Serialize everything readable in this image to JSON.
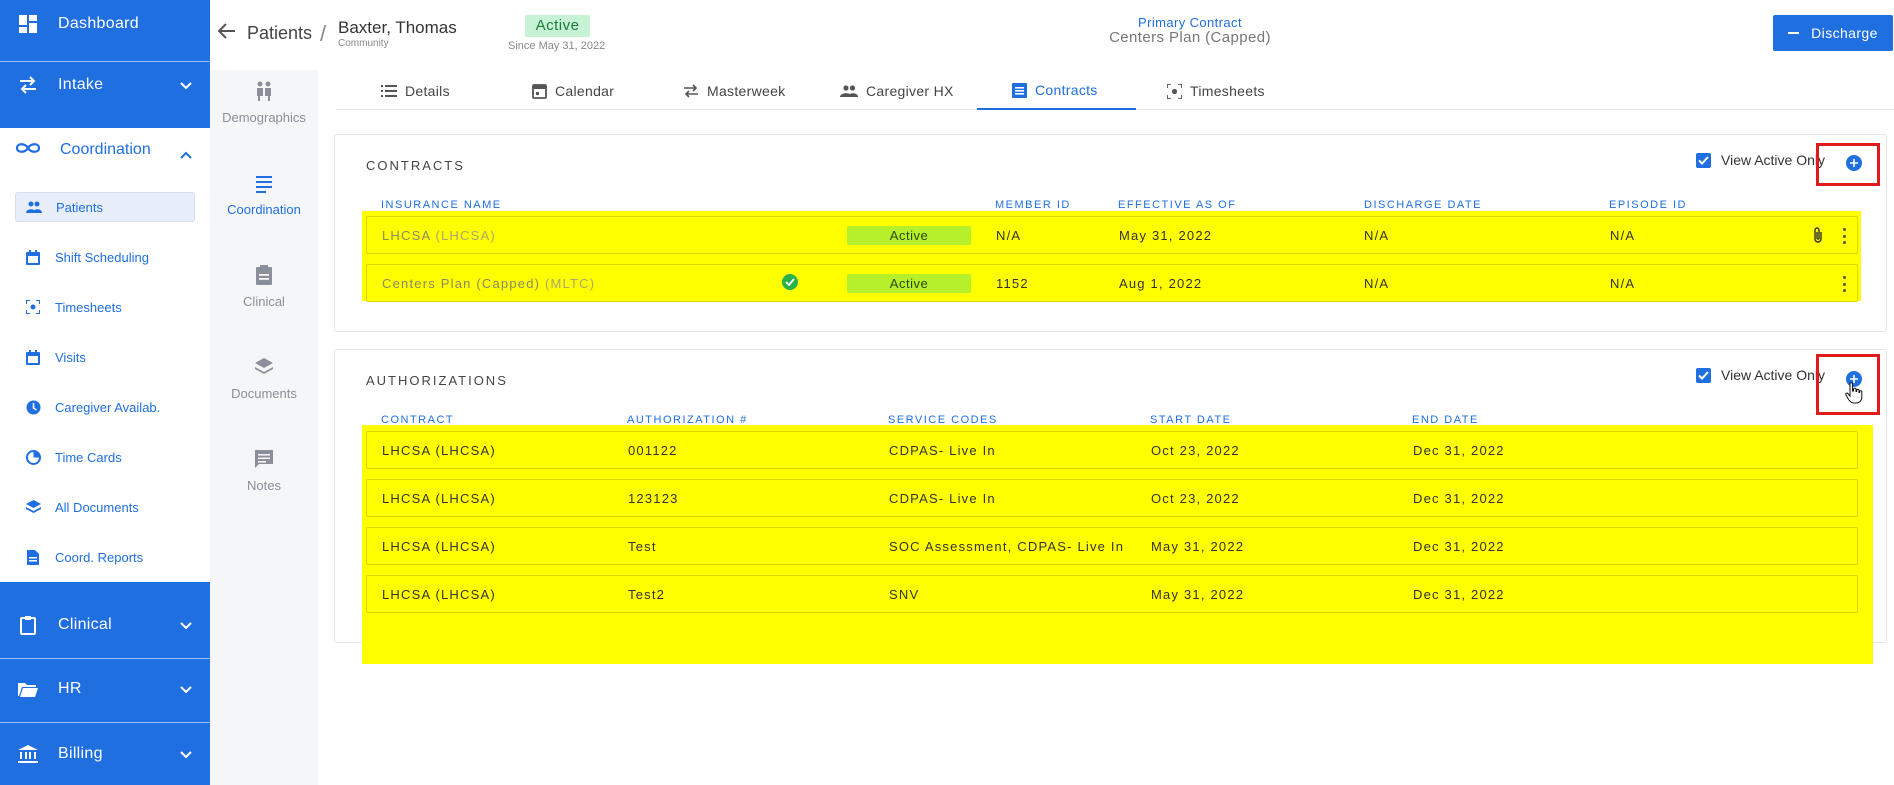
{
  "nav": {
    "dashboard": "Dashboard",
    "intake": "Intake",
    "coordination": "Coordination",
    "sub_items": [
      "Patients",
      "Shift Scheduling",
      "Timesheets",
      "Visits",
      "Caregiver Availab.",
      "Time Cards",
      "All Documents",
      "Coord. Reports"
    ],
    "clinical": "Clinical",
    "hr": "HR",
    "billing": "Billing"
  },
  "subnav": [
    "Demographics",
    "Coordination",
    "Clinical",
    "Documents",
    "Notes"
  ],
  "header": {
    "crumb": "Patients",
    "slash": "/",
    "name": "Baxter, Thomas",
    "subtitle": "Community",
    "status": "Active",
    "since": "Since May 31, 2022",
    "primary_contract_label": "Primary Contract",
    "primary_contract_value": "Centers Plan (Capped)",
    "discharge_label": "Discharge"
  },
  "tabs": [
    "Details",
    "Calendar",
    "Masterweek",
    "Caregiver HX",
    "Contracts",
    "Timesheets"
  ],
  "contracts": {
    "title": "CONTRACTS",
    "view_active_only": "View Active Only",
    "columns": [
      "INSURANCE NAME",
      "MEMBER ID",
      "EFFECTIVE AS OF",
      "DISCHARGE DATE",
      "EPISODE ID"
    ],
    "rows": [
      {
        "name": "LHCSA",
        "code": "(LHCSA)",
        "status": "Active",
        "member_id": "N/A",
        "effective": "May 31, 2022",
        "discharge": "N/A",
        "episode": "N/A"
      },
      {
        "name": "Centers Plan (Capped)",
        "code": "(MLTC)",
        "status": "Active",
        "member_id": "1152",
        "effective": "Aug 1, 2022",
        "discharge": "N/A",
        "episode": "N/A"
      }
    ]
  },
  "authorizations": {
    "title": "AUTHORIZATIONS",
    "view_active_only": "View Active Only",
    "columns": [
      "CONTRACT",
      "AUTHORIZATION #",
      "SERVICE CODES",
      "START DATE",
      "END DATE"
    ],
    "rows": [
      {
        "contract": "LHCSA (LHCSA)",
        "auth": "001122",
        "codes": "CDPAS- Live In",
        "start": "Oct 23, 2022",
        "end": "Dec 31, 2022"
      },
      {
        "contract": "LHCSA (LHCSA)",
        "auth": "123123",
        "codes": "CDPAS- Live In",
        "start": "Oct 23, 2022",
        "end": "Dec 31, 2022"
      },
      {
        "contract": "LHCSA (LHCSA)",
        "auth": "Test",
        "codes": "SOC Assessment, CDPAS- Live In",
        "start": "May 31, 2022",
        "end": "Dec 31, 2022"
      },
      {
        "contract": "LHCSA (LHCSA)",
        "auth": "Test2",
        "codes": "SNV",
        "start": "May 31, 2022",
        "end": "Dec 31, 2022"
      }
    ]
  },
  "colors": {
    "brand": "#1f6fe0",
    "highlight": "#ffff00",
    "annotation": "#e01b1b",
    "active_badge": "#b6f02a"
  }
}
